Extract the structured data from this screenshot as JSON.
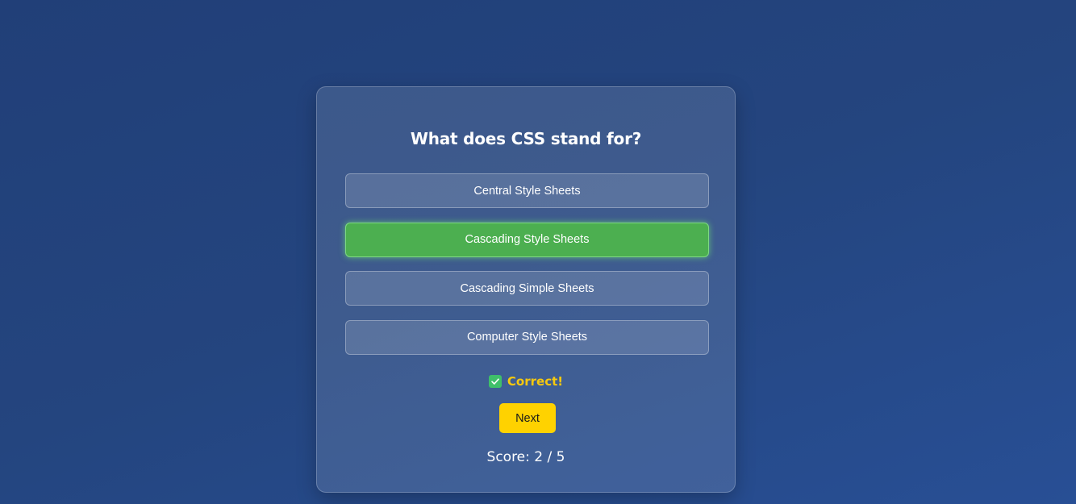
{
  "quiz": {
    "question": "What does CSS stand for?",
    "options": [
      {
        "label": "Central Style Sheets",
        "state": "default"
      },
      {
        "label": "Cascading Style Sheets",
        "state": "correct"
      },
      {
        "label": "Cascading Simple Sheets",
        "state": "default"
      },
      {
        "label": "Computer Style Sheets",
        "state": "default"
      }
    ],
    "feedback": {
      "icon": "check-icon",
      "text": "Correct!"
    },
    "next_label": "Next",
    "score_text": "Score: 2 / 5"
  },
  "colors": {
    "correct": "#4caf50",
    "accent": "#ffd200",
    "feedback_text": "#f6c90e",
    "check_icon_bg": "#3fbf6a"
  }
}
